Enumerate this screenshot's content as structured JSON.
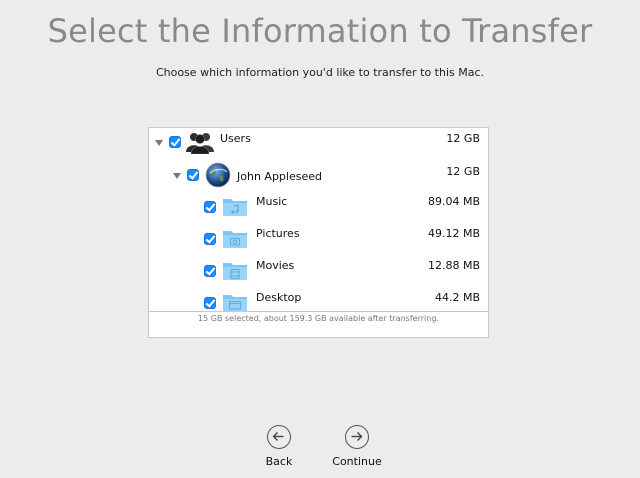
{
  "header": {
    "title": "Select the Information to Transfer",
    "subtitle": "Choose which information you'd like to transfer to this Mac."
  },
  "transfer_list": {
    "items": [
      {
        "label": "Users",
        "size": "12 GB",
        "checked": true,
        "expanded": true,
        "icon": "users-icon"
      },
      {
        "label": "John Appleseed",
        "size": "12 GB",
        "checked": true,
        "expanded": true,
        "icon": "earth-avatar-icon"
      },
      {
        "label": "Music",
        "size": "89.04 MB",
        "checked": true,
        "icon": "music-folder-icon"
      },
      {
        "label": "Pictures",
        "size": "49.12 MB",
        "checked": true,
        "icon": "pictures-folder-icon"
      },
      {
        "label": "Movies",
        "size": "12.88 MB",
        "checked": true,
        "icon": "movies-folder-icon"
      },
      {
        "label": "Desktop",
        "size": "44.2 MB",
        "checked": true,
        "icon": "desktop-folder-icon"
      }
    ],
    "footer": "15 GB selected, about 159.3 GB available after transferring."
  },
  "nav": {
    "back_label": "Back",
    "continue_label": "Continue"
  },
  "colors": {
    "accent": "#1a8cff",
    "folder": "#7cc4f2",
    "title": "#8a8a8a",
    "background": "#ececec"
  }
}
